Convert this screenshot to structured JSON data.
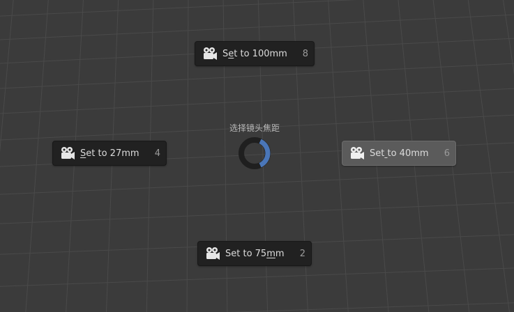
{
  "pie_menu": {
    "title": "选择镜头焦距",
    "direction_indicator_color": "#4a76b8",
    "items": [
      {
        "id": "top",
        "label_pre": "S",
        "label_ul": "e",
        "label_post": "t to 100mm",
        "hotkey": "8",
        "icon": "camera-icon",
        "active": false
      },
      {
        "id": "left",
        "label_pre": "",
        "label_ul": "S",
        "label_post": "et to 27mm",
        "hotkey": "4",
        "icon": "camera-icon",
        "active": false
      },
      {
        "id": "right",
        "label_pre": "Set",
        "label_ul": " ",
        "label_post": "to 40mm",
        "hotkey": "6",
        "icon": "camera-icon",
        "active": true
      },
      {
        "id": "bottom",
        "label_pre": "Set to 75",
        "label_ul": "m",
        "label_post": "m",
        "hotkey": "2",
        "icon": "camera-icon",
        "active": false
      }
    ]
  }
}
